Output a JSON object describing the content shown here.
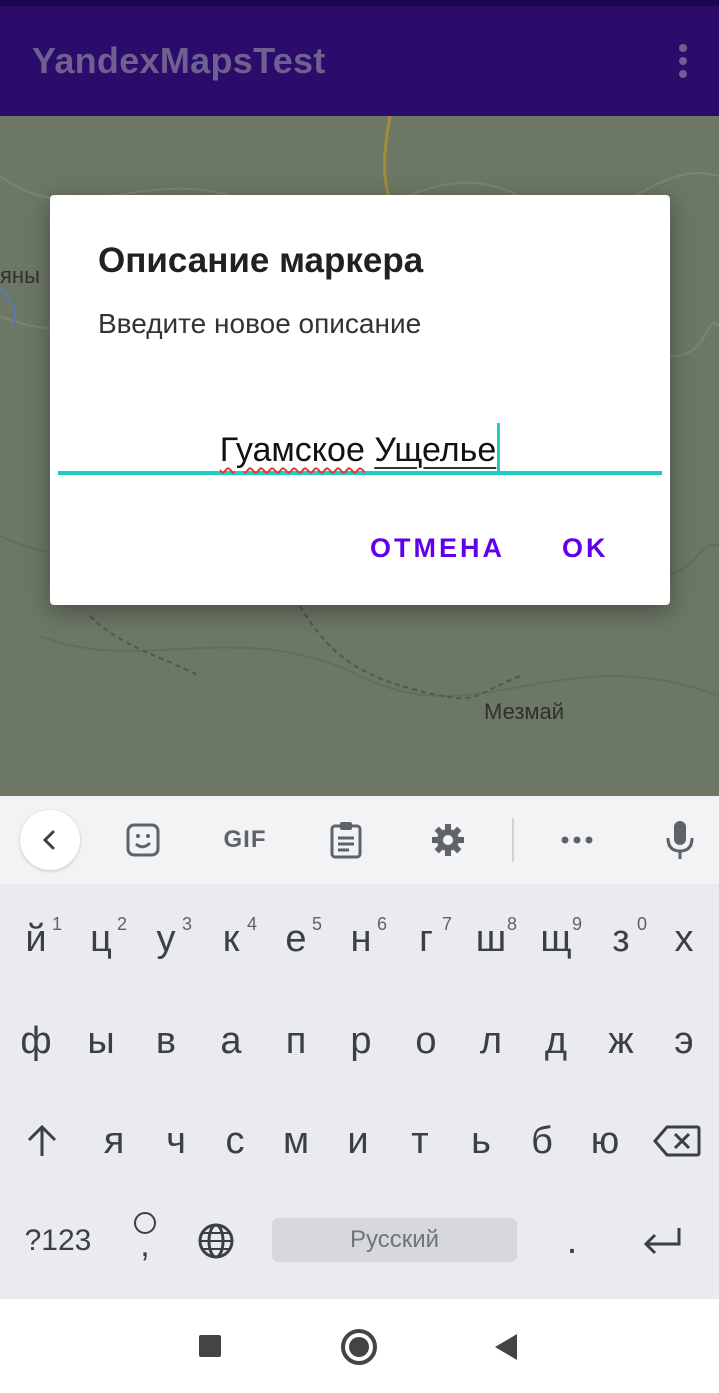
{
  "app": {
    "title": "YandexMapsTest"
  },
  "map": {
    "labels": [
      "яны",
      "Мезмай"
    ]
  },
  "dialog": {
    "title": "Описание маркера",
    "message": "Введите новое описание",
    "input_word1": "Гуамское",
    "input_word2": "Ущелье",
    "cancel_label": "ОТМЕНА",
    "ok_label": "OK"
  },
  "keyboard": {
    "toolbar": {
      "gif_label": "GIF"
    },
    "row1": [
      {
        "k": "й",
        "h": "1"
      },
      {
        "k": "ц",
        "h": "2"
      },
      {
        "k": "у",
        "h": "3"
      },
      {
        "k": "к",
        "h": "4"
      },
      {
        "k": "е",
        "h": "5"
      },
      {
        "k": "н",
        "h": "6"
      },
      {
        "k": "г",
        "h": "7"
      },
      {
        "k": "ш",
        "h": "8"
      },
      {
        "k": "щ",
        "h": "9"
      },
      {
        "k": "з",
        "h": "0"
      },
      {
        "k": "х",
        "h": ""
      }
    ],
    "row2": [
      "ф",
      "ы",
      "в",
      "а",
      "п",
      "р",
      "о",
      "л",
      "д",
      "ж",
      "э"
    ],
    "row3": [
      "я",
      "ч",
      "с",
      "м",
      "и",
      "т",
      "ь",
      "б",
      "ю"
    ],
    "symbols_label": "?123",
    "comma_label": ",",
    "period_label": ".",
    "space_label": "Русский"
  },
  "colors": {
    "appbar": "#2b0c6a",
    "accent": "#6200ea",
    "input_underline": "#1ccfc0"
  }
}
